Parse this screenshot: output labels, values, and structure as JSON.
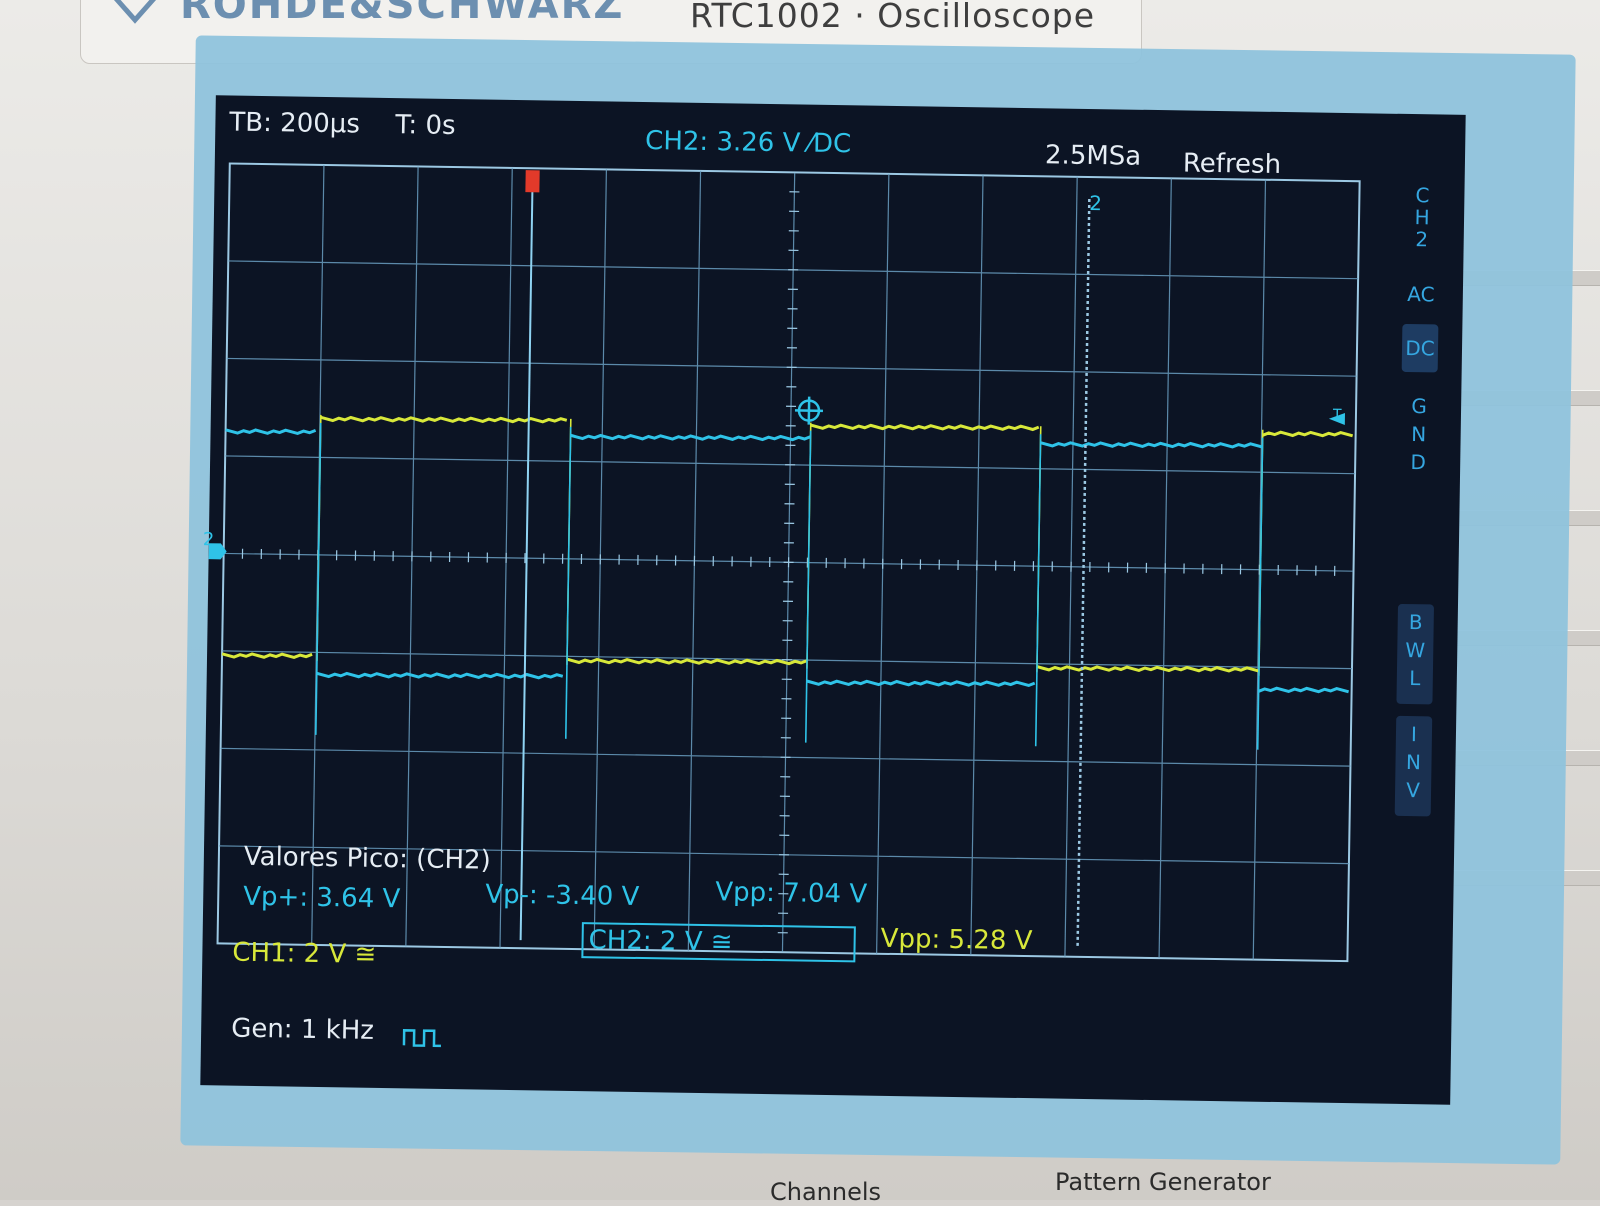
{
  "device": {
    "brand": "ROHDE&SCHWARZ",
    "model": "RTC1002 · Oscilloscope",
    "bottom_labels": [
      "Channels",
      "Pattern Generator"
    ]
  },
  "scope": {
    "timebase": "TB: 200µs",
    "trigger_time": "T: 0s",
    "trigger_info": "CH2: 3.26 V ⁄DC",
    "sample_rate": "2.5MSa",
    "mode": "Refresh",
    "sidebar": {
      "channel": "CH2",
      "coupling_options": [
        "AC",
        "DC",
        "GND"
      ],
      "selected_coupling": "DC",
      "bwl": "BWL",
      "inv": "INV"
    },
    "measurement": {
      "title": "Valores Pico: (CH2)",
      "vp_plus": "Vp+: 3.64 V",
      "vp_minus": "Vp-: -3.40 V",
      "vpp_ch2": "Vpp: 7.04 V",
      "vpp_ch1": "Vpp: 5.28 V"
    },
    "ch1_scale": "CH1: 2 V ≅",
    "ch2_scale": "CH2: 2 V ≅",
    "generator": "Gen: 1 kHz",
    "cursor_label": "2",
    "ch2_marker": "2",
    "trigger_marker": "T"
  },
  "colors": {
    "ch1": "#d8e83a",
    "ch2": "#2fc3e8",
    "grid": "#7fb6d6",
    "screen_bg": "#0c1424",
    "trigger_marker": "#e23a2a",
    "bezel_tape": "#8fc3dc"
  },
  "icons": {
    "generator_wave": "square-wave-icon",
    "trigger_crosshair": "crosshair-icon"
  }
}
